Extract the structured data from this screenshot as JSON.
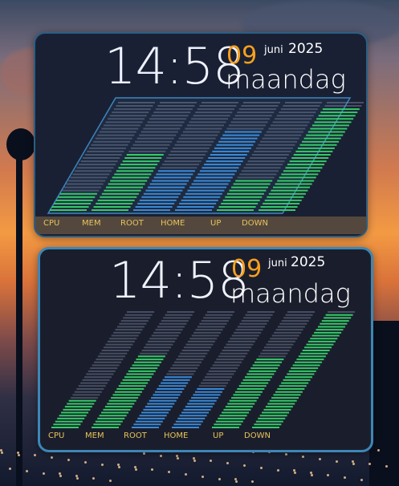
{
  "widgets": [
    {
      "time": "14:58",
      "day": "09",
      "month": "juni",
      "year": "2025",
      "weekday": "maandag",
      "labels": [
        "CPU",
        "MEM",
        "ROOT",
        "HOME",
        "UP",
        "DOWN"
      ],
      "levels": [
        0.17,
        0.53,
        0.38,
        0.73,
        0.3,
        0.93
      ]
    },
    {
      "time": "14:58",
      "day": "09",
      "month": "juni",
      "year": "2025",
      "weekday": "maandag",
      "labels": [
        "CPU",
        "MEM",
        "ROOT",
        "HOME",
        "UP",
        "DOWN"
      ],
      "levels": [
        0.25,
        0.62,
        0.44,
        0.35,
        0.6,
        0.98
      ]
    }
  ],
  "colors": {
    "accent": "#f7a01e",
    "label": "#e8c45a",
    "green": "#37d46b",
    "blue": "#3c8fe0",
    "inactive": "#7f8aa3"
  }
}
